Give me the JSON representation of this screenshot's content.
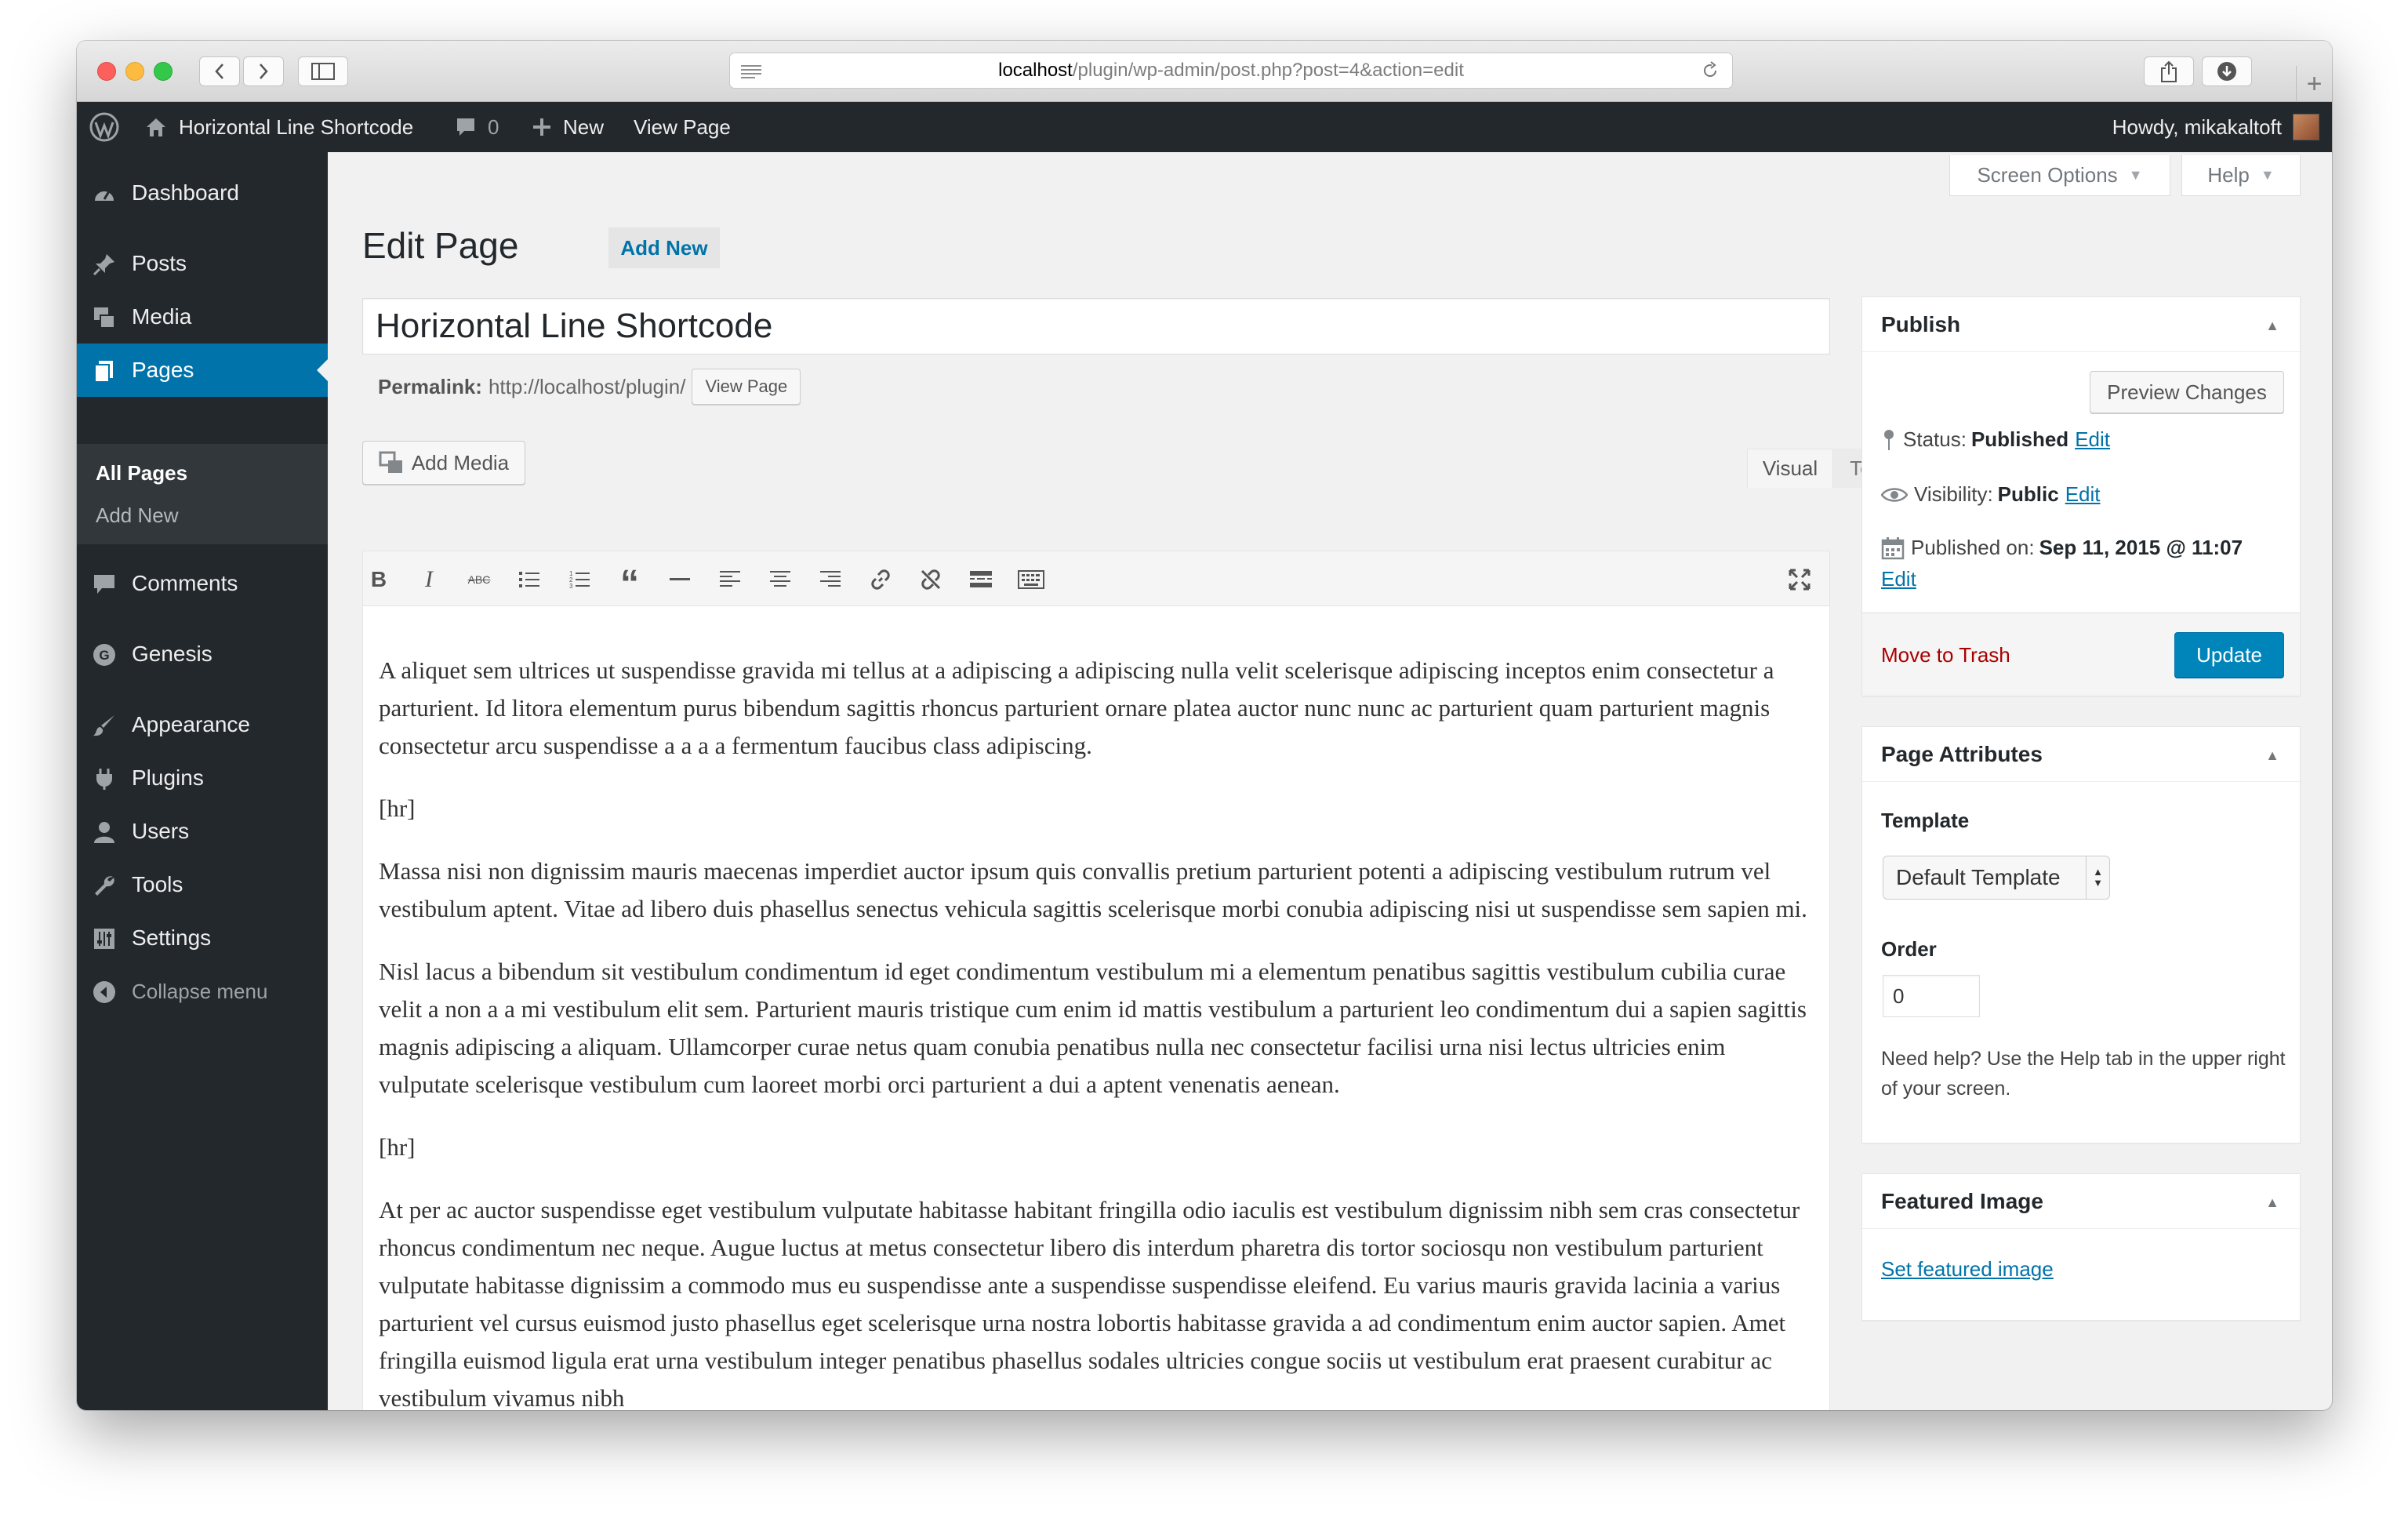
{
  "browser": {
    "url_host": "localhost",
    "url_path": "/plugin/wp-admin/post.php?post=4&action=edit"
  },
  "admin_bar": {
    "site_name": "Horizontal Line Shortcode",
    "comments_count": "0",
    "new_label": "New",
    "view_page_label": "View Page",
    "howdy": "Howdy, mikakaltoft"
  },
  "sidebar": {
    "items": [
      {
        "label": "Dashboard",
        "icon": "dashboard-icon"
      },
      {
        "label": "Posts",
        "icon": "pin-icon"
      },
      {
        "label": "Media",
        "icon": "media-icon"
      },
      {
        "label": "Pages",
        "icon": "pages-icon"
      },
      {
        "label": "Comments",
        "icon": "comment-icon"
      },
      {
        "label": "Genesis",
        "icon": "genesis-icon"
      },
      {
        "label": "Appearance",
        "icon": "brush-icon"
      },
      {
        "label": "Plugins",
        "icon": "plug-icon"
      },
      {
        "label": "Users",
        "icon": "user-icon"
      },
      {
        "label": "Tools",
        "icon": "wrench-icon"
      },
      {
        "label": "Settings",
        "icon": "settings-icon"
      }
    ],
    "submenu": [
      "All Pages",
      "Add New"
    ],
    "collapse_label": "Collapse menu"
  },
  "header": {
    "screen_options": "Screen Options",
    "help": "Help",
    "title": "Edit Page",
    "add_new": "Add New"
  },
  "editor": {
    "post_title": "Horizontal Line Shortcode",
    "permalink_label": "Permalink:",
    "permalink_url": "http://localhost/plugin/",
    "view_page": "View Page",
    "add_media": "Add Media",
    "tab_visual": "Visual",
    "tab_text": "Text",
    "paragraphs": [
      "A aliquet sem ultrices ut suspendisse gravida mi tellus at a adipiscing a adipiscing nulla velit scelerisque adipiscing inceptos enim consectetur a parturient. Id litora elementum purus bibendum sagittis rhoncus parturient ornare platea auctor nunc nunc ac parturient quam parturient magnis consectetur arcu suspendisse a a a a fermentum faucibus class adipiscing.",
      "[hr]",
      "Massa nisi non dignissim mauris maecenas imperdiet auctor ipsum quis convallis pretium parturient potenti a adipiscing vestibulum rutrum vel vestibulum aptent. Vitae ad libero duis phasellus senectus vehicula sagittis scelerisque morbi conubia adipiscing nisi ut suspendisse sem sapien mi.",
      "Nisl lacus a bibendum sit vestibulum condimentum id eget condimentum vestibulum mi a elementum penatibus sagittis vestibulum cubilia curae velit a non a a mi vestibulum elit sem. Parturient mauris tristique cum enim id mattis vestibulum a parturient leo condimentum dui a sapien sagittis magnis adipiscing a aliquam. Ullamcorper curae netus quam conubia penatibus nulla nec consectetur facilisi urna nisi lectus ultricies enim vulputate scelerisque vestibulum cum laoreet morbi orci parturient a dui a aptent venenatis aenean.",
      "[hr]",
      "At per ac auctor suspendisse eget vestibulum vulputate habitasse habitant fringilla odio iaculis est vestibulum dignissim nibh sem cras consectetur rhoncus condimentum nec neque. Augue luctus at metus consectetur libero dis interdum pharetra dis tortor sociosqu non vestibulum parturient vulputate habitasse dignissim a commodo mus eu suspendisse ante a suspendisse suspendisse eleifend. Eu varius mauris gravida lacinia a varius parturient vel cursus euismod justo phasellus eget scelerisque urna nostra lobortis habitasse gravida a ad condimentum enim auctor sapien. Amet fringilla euismod ligula erat urna vestibulum integer penatibus phasellus sodales ultricies congue sociis ut vestibulum erat praesent curabitur ac vestibulum vivamus nibh"
    ]
  },
  "publish": {
    "title": "Publish",
    "preview": "Preview Changes",
    "status_label": "Status:",
    "status_value": "Published",
    "visibility_label": "Visibility:",
    "visibility_value": "Public",
    "published_label": "Published on:",
    "published_value": "Sep 11, 2015 @ 11:07",
    "edit": "Edit",
    "trash": "Move to Trash",
    "update": "Update"
  },
  "attributes": {
    "title": "Page Attributes",
    "template_label": "Template",
    "template_value": "Default Template",
    "order_label": "Order",
    "order_value": "0",
    "help_text": "Need help? Use the Help tab in the upper right of your screen."
  },
  "featured": {
    "title": "Featured Image",
    "link": "Set featured image"
  }
}
